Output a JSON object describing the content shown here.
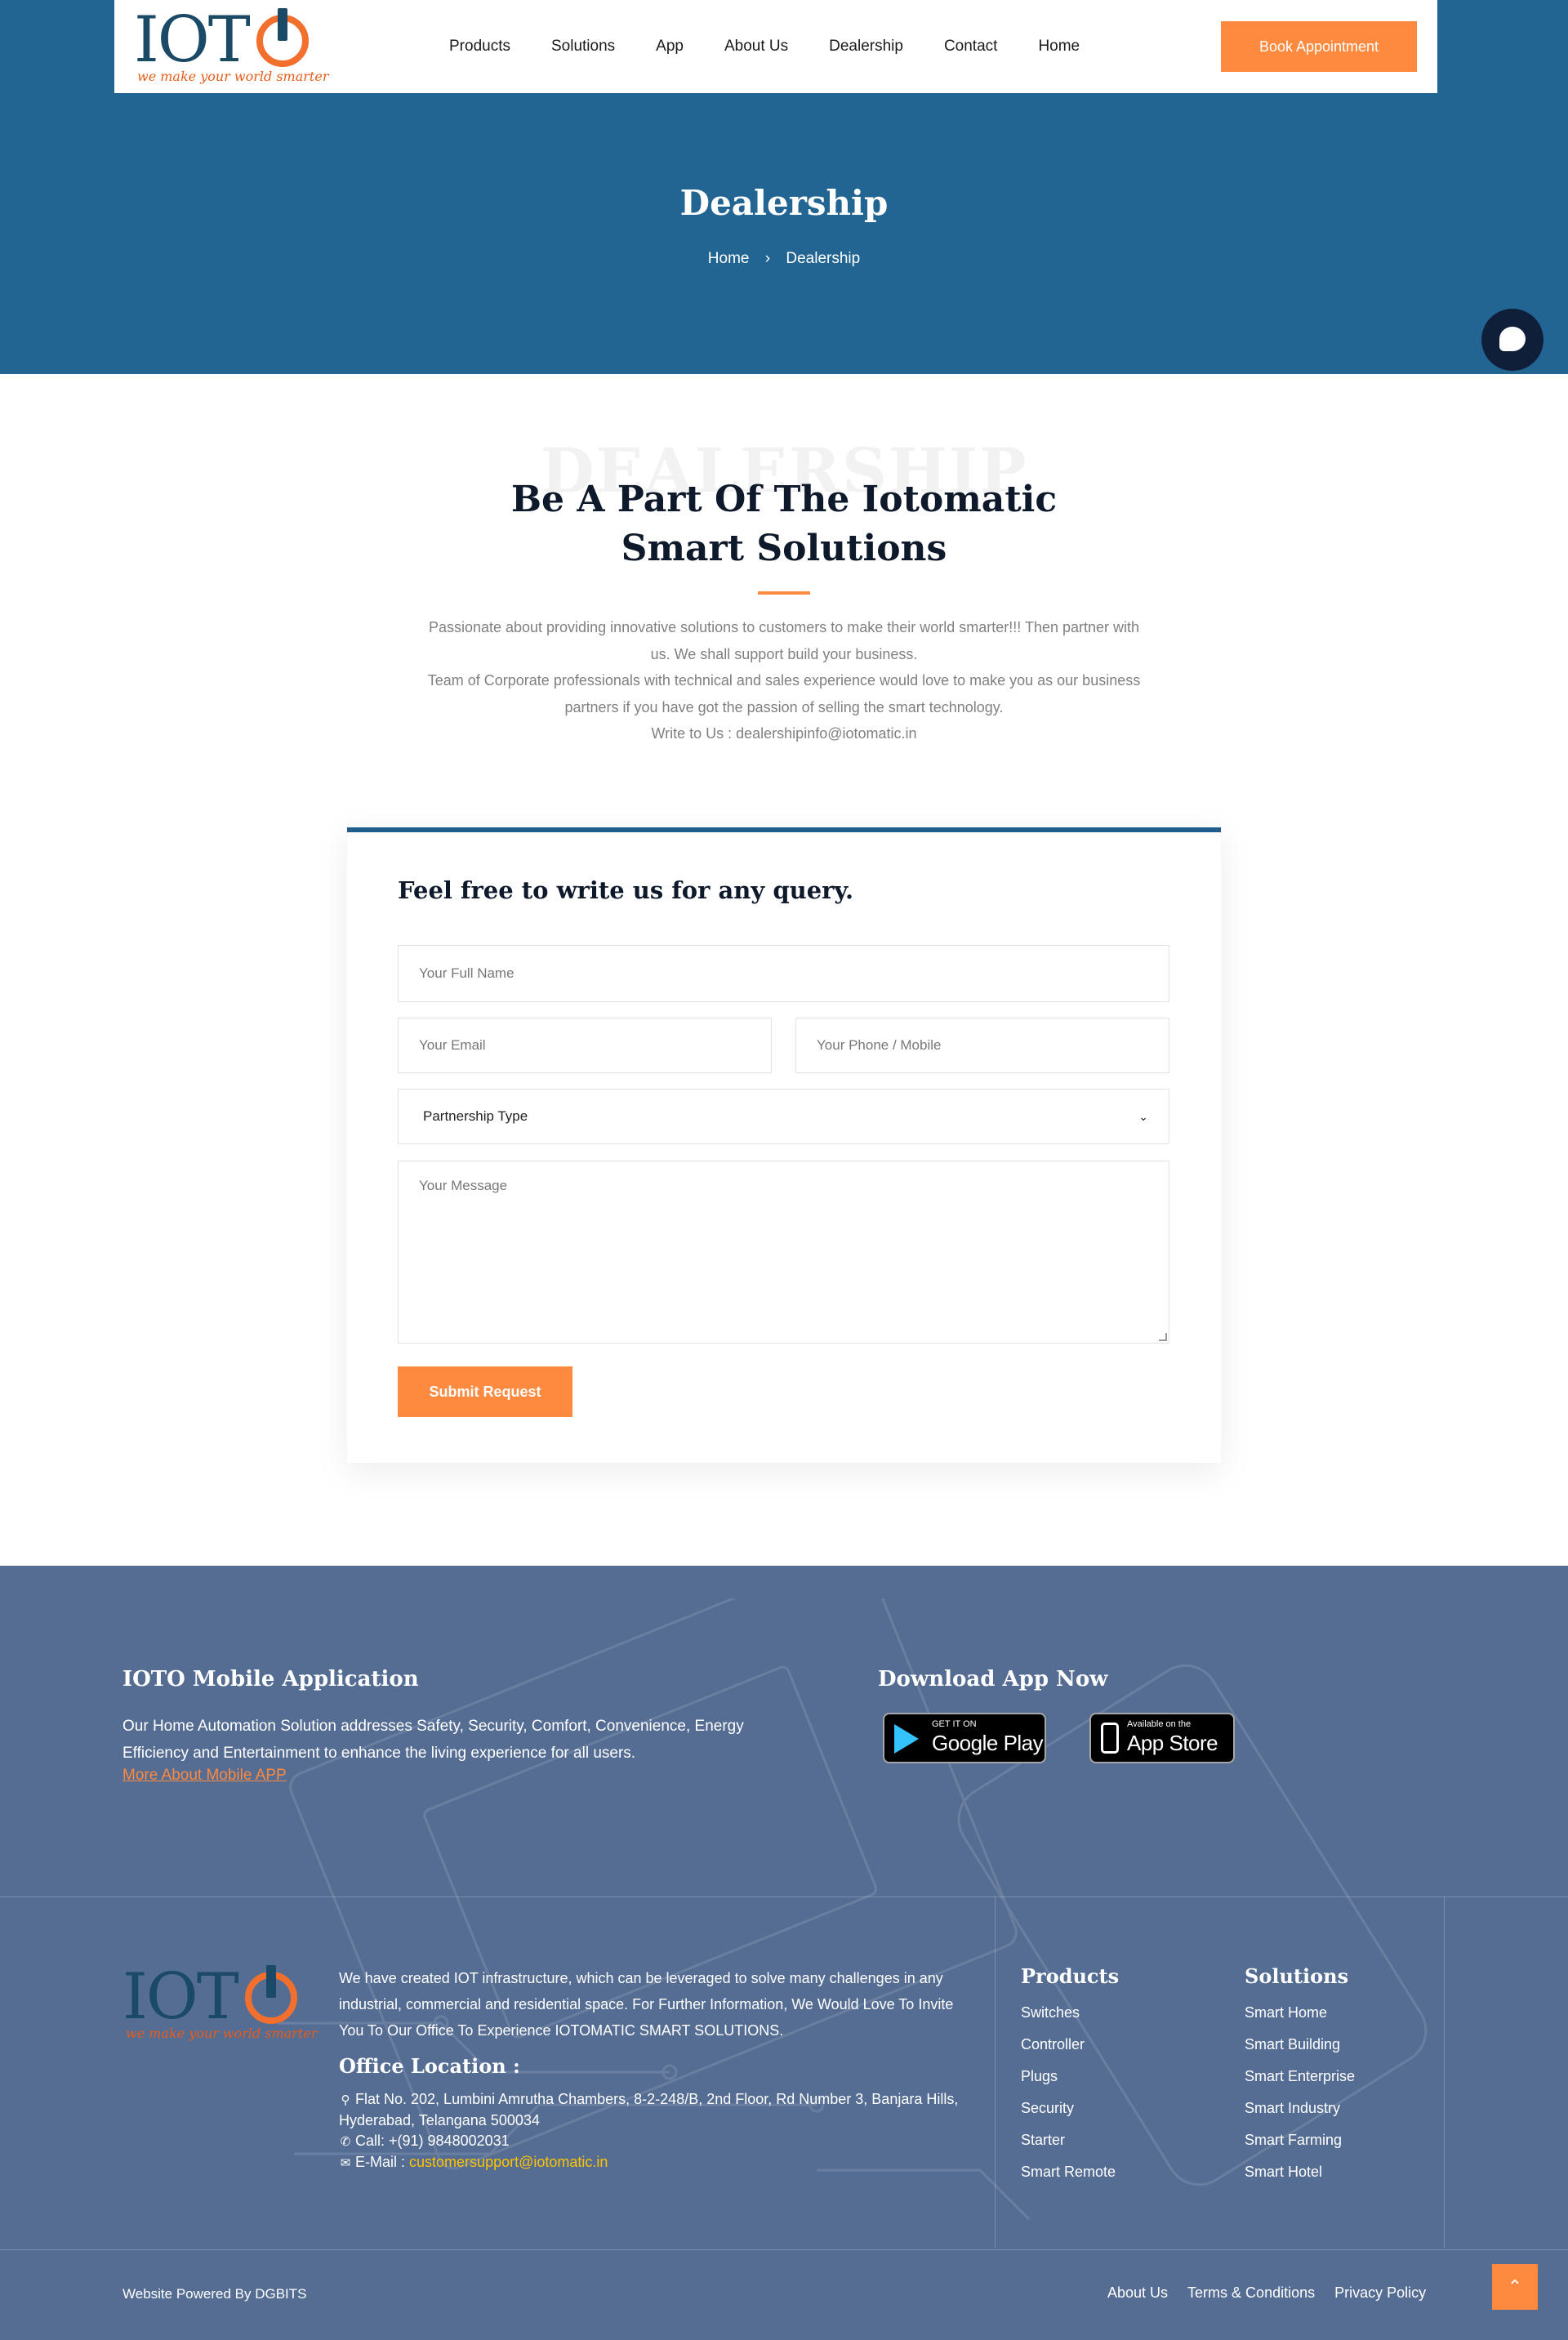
{
  "brand": {
    "logo_text": "IOT",
    "tagline": "we make your world smarter"
  },
  "nav": {
    "items": [
      "Products",
      "Solutions",
      "App",
      "About Us",
      "Dealership",
      "Contact",
      "Home"
    ],
    "cta": "Book Appointment"
  },
  "hero": {
    "title": "Dealership",
    "breadcrumb": {
      "home": "Home",
      "separator": "›",
      "current": "Dealership"
    }
  },
  "intro": {
    "ghost_word": "DEALERSHIP",
    "title": "Be A Part Of The Iotomatic Smart Solutions",
    "paragraphs": [
      "Passionate about providing innovative solutions to customers to make their world smarter!!! Then partner with us. We shall support build your business.",
      "Team of Corporate professionals with technical and sales experience would love to make you as our business partners if you have got the passion of selling the smart technology.",
      "Write to Us : dealershipinfo@iotomatic.in"
    ]
  },
  "form": {
    "heading": "Feel free to write us for any query.",
    "name_placeholder": "Your Full Name",
    "email_placeholder": "Your Email",
    "phone_placeholder": "Your Phone / Mobile",
    "partnership_selected": "Partnership Type",
    "message_placeholder": "Your Message",
    "submit_label": "Submit Request"
  },
  "footer": {
    "app_title": "IOTO Mobile Application",
    "app_desc": "Our Home Automation Solution addresses Safety, Security, Comfort, Convenience, Energy Efficiency and Entertainment to enhance the living experience for all users.",
    "app_link": "More About Mobile APP",
    "download_title": "Download App Now",
    "google_play": {
      "sub": "GET IT ON",
      "main": "Google Play"
    },
    "app_store": {
      "sub": "Available on the",
      "main": "App Store"
    },
    "about": "We have created IOT infrastructure, which can be leveraged to solve many challenges in any industrial, commercial and residential space. For Further Information, We Would Love To Invite You To Our Office To Experience IOTOMATIC SMART SOLUTIONS.",
    "office_title": "Office Location :",
    "address": "Flat No. 202, Lumbini Amrutha Chambers, 8-2-248/B, 2nd Floor, Rd Number 3, Banjara Hills, Hyderabad, Telangana 500034",
    "call": "Call: +(91) 9848002031",
    "email_label": "E-Mail :",
    "email_value": "customersupport@iotomatic.in",
    "products_title": "Products",
    "products": [
      "Switches",
      "Controller",
      "Plugs",
      "Security",
      "Starter",
      "Smart Remote"
    ],
    "solutions_title": "Solutions",
    "solutions": [
      "Smart Home",
      "Smart Building",
      "Smart Enterprise",
      "Smart Industry",
      "Smart Farming",
      "Smart Hotel"
    ],
    "powered_by": "Website Powered By DGBITS",
    "bottom_links": [
      "About Us",
      "Terms & Conditions",
      "Privacy Policy"
    ]
  },
  "colors": {
    "hero_blue": "#236592",
    "accent_orange": "#fe8a3f",
    "footer_blue": "#556d93",
    "email_yellow": "#ffc400"
  },
  "icons": {
    "chat": "chat-bubble-icon",
    "location": "map-pin-icon",
    "phone": "phone-icon",
    "mail": "envelope-icon",
    "scroll_top": "chevron-up-icon"
  }
}
